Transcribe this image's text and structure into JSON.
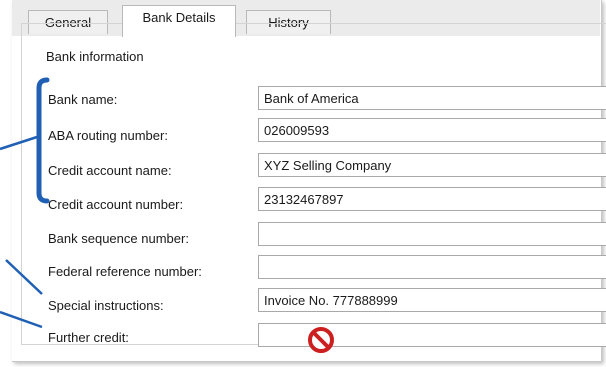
{
  "tabs": [
    {
      "label": "General",
      "active": false
    },
    {
      "label": "Bank Details",
      "active": true
    },
    {
      "label": "History",
      "active": false
    }
  ],
  "group": {
    "title": "Bank information"
  },
  "fields": [
    {
      "label": "Bank name:",
      "value": ""
    },
    {
      "label": "ABA routing number:",
      "value": "026009593"
    },
    {
      "label": "Credit account name:",
      "value": "XYZ Selling Company"
    },
    {
      "label": "Credit account number:",
      "value": "23132467897"
    },
    {
      "label": "Bank sequence number:",
      "value": ""
    },
    {
      "label": "Federal reference number:",
      "value": ""
    },
    {
      "label": "Special instructions:",
      "value": "Invoice No. 777888999"
    },
    {
      "label": "Further credit:",
      "value": ""
    }
  ],
  "bank_name_value": "Bank of America",
  "annotation_color": "#1f5fb4",
  "no_entry_icon": "no-entry-icon",
  "no_entry_color": "#cc1f1f"
}
